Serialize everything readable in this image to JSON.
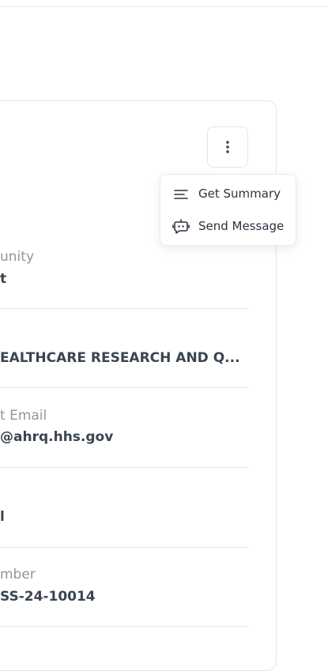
{
  "menu": {
    "items": [
      {
        "label": "Get Summary",
        "icon": "lines-icon"
      },
      {
        "label": "Send Message",
        "icon": "chat-bot-icon"
      }
    ]
  },
  "fields": [
    {
      "label": "unity",
      "value": "t"
    },
    {
      "label": "",
      "value": "EALTHCARE RESEARCH AND Q..."
    },
    {
      "label": "t Email",
      "value": "@ahrq.hhs.gov"
    },
    {
      "label": "",
      "value": "l"
    },
    {
      "label": "mber",
      "value": "SS-24-10014"
    }
  ],
  "colors": {
    "label": "#8f969f",
    "value": "#3b4450",
    "border": "#e5e7eb"
  }
}
